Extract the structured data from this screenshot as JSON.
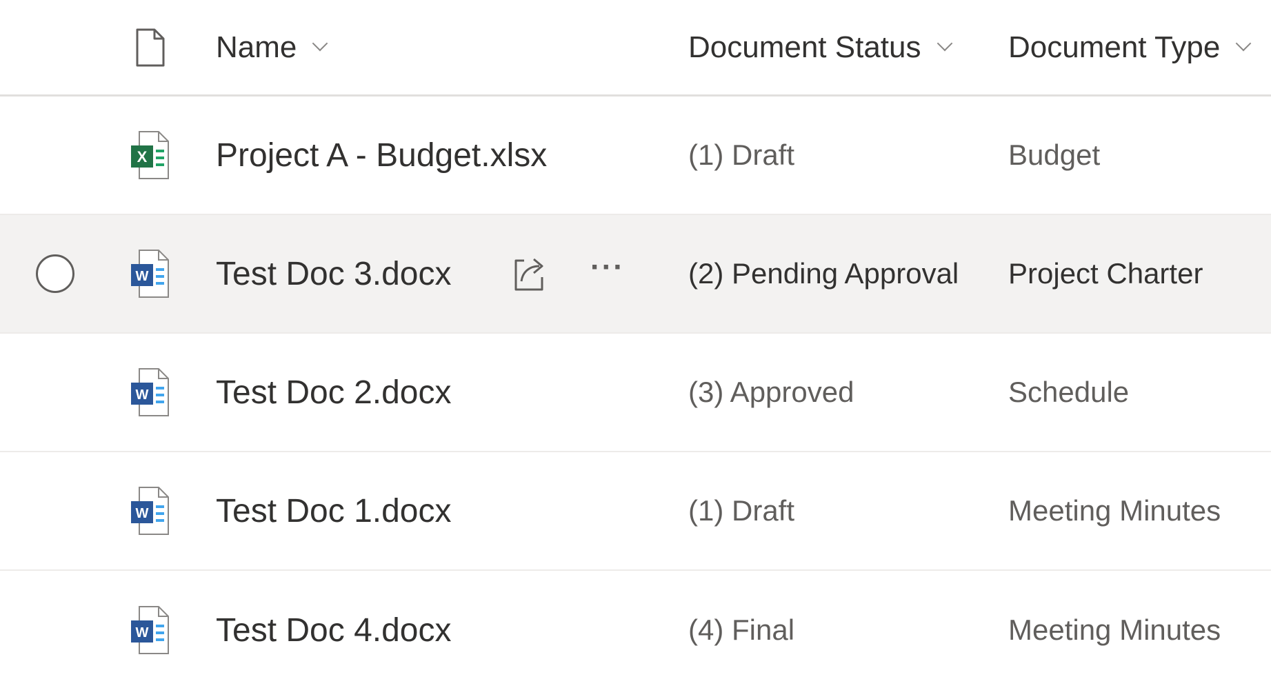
{
  "columns": {
    "name": "Name",
    "status": "Document Status",
    "type": "Document Type"
  },
  "icons": {
    "header_file": "file-icon",
    "excel": "excel-file-icon",
    "word": "word-file-icon",
    "share": "share-icon",
    "more": "more-icon",
    "sort": "chevron-down-icon"
  },
  "colors": {
    "excel_green": "#217346",
    "word_blue": "#2b579a",
    "hover_row": "#f3f2f1"
  },
  "more_glyph": "···",
  "rows": [
    {
      "name": "Project A - Budget.xlsx",
      "status": "(1) Draft",
      "type": "Budget",
      "file_type": "excel"
    },
    {
      "name": "Test Doc 3.docx",
      "status": "(2) Pending Approval",
      "type": "Project Charter",
      "file_type": "word"
    },
    {
      "name": "Test Doc 2.docx",
      "status": "(3) Approved",
      "type": "Schedule",
      "file_type": "word"
    },
    {
      "name": "Test Doc 1.docx",
      "status": "(1) Draft",
      "type": "Meeting Minutes",
      "file_type": "word"
    },
    {
      "name": "Test Doc 4.docx",
      "status": "(4) Final",
      "type": "Meeting Minutes",
      "file_type": "word"
    }
  ]
}
